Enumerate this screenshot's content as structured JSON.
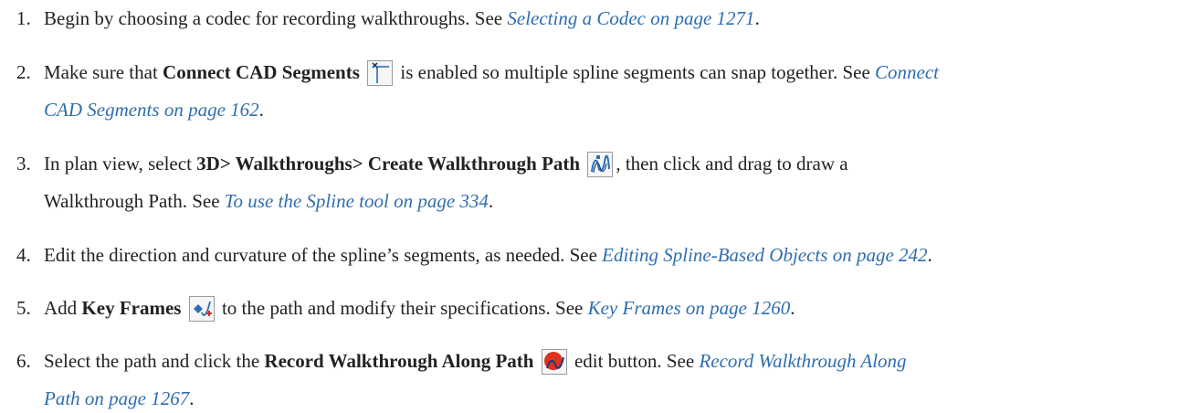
{
  "steps": [
    {
      "number": "1.",
      "text1": "Begin by choosing a codec for recording walkthroughs. See ",
      "link": "Selecting a Codec on page 1271",
      "end": "."
    },
    {
      "number": "2.",
      "text1": "Make sure that ",
      "bold": "Connect CAD Segments",
      "text2": " is enabled so multiple spline segments can snap together. See ",
      "link_a": "Connect",
      "link_b": "CAD Segments on page 162",
      "end": ".",
      "icon": "connect-cad-segments-icon"
    },
    {
      "number": "3.",
      "text1": "In plan view, select ",
      "bold": "3D> Walkthroughs> Create Walkthrough Path",
      "text2": ", then click and drag to draw a",
      "text3": "Walkthrough Path. See ",
      "link": "To use the Spline tool on page 334",
      "end": ".",
      "icon": "create-walkthrough-path-icon"
    },
    {
      "number": "4.",
      "text1": "Edit the direction and curvature of the spline’s segments, as needed. See ",
      "link": "Editing Spline-Based Objects on page 242",
      "end": "."
    },
    {
      "number": "5.",
      "text1": "Add ",
      "bold": "Key Frames",
      "text2": " to the path and modify their specifications. See ",
      "link": "Key Frames on page 1260",
      "end": ".",
      "icon": "key-frames-icon"
    },
    {
      "number": "6.",
      "text1": "Select the path and click the ",
      "bold": "Record Walkthrough Along Path",
      "text2": " edit button. See ",
      "link_a": "Record Walkthrough Along",
      "link_b": "Path on page 1267",
      "end": ".",
      "icon": "record-walkthrough-icon"
    }
  ]
}
